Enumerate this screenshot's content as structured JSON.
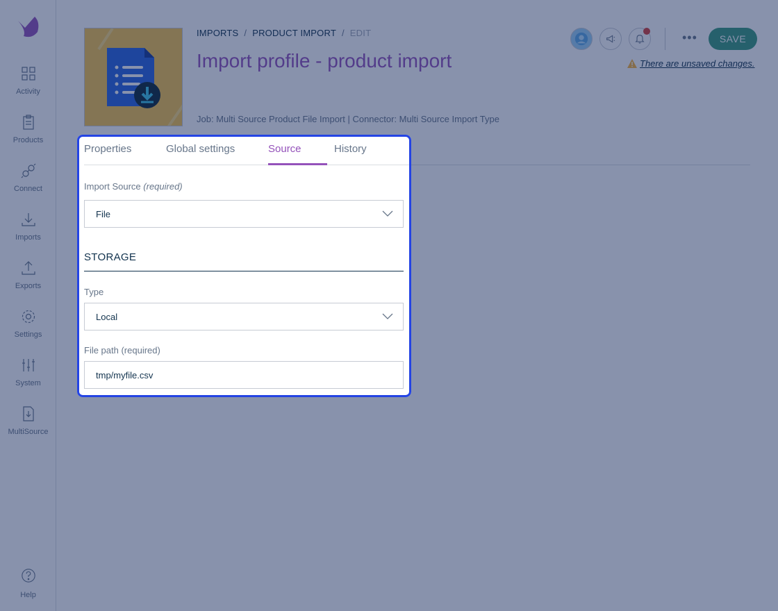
{
  "sidebar": {
    "items": [
      {
        "label": "Activity",
        "icon": "dashboard-icon"
      },
      {
        "label": "Products",
        "icon": "clipboard-icon"
      },
      {
        "label": "Connect",
        "icon": "plug-icon"
      },
      {
        "label": "Imports",
        "icon": "download-icon"
      },
      {
        "label": "Exports",
        "icon": "upload-icon"
      },
      {
        "label": "Settings",
        "icon": "gear-icon"
      },
      {
        "label": "System",
        "icon": "sliders-icon"
      },
      {
        "label": "MultiSource",
        "icon": "file-import-icon"
      }
    ],
    "help_label": "Help"
  },
  "breadcrumb": {
    "level1": "IMPORTS",
    "separator": "/",
    "level2": "PRODUCT IMPORT",
    "level3": "EDIT"
  },
  "header": {
    "title": "Import profile - product import",
    "subline": "Job: Multi Source Product File Import | Connector: Multi Source Import Type",
    "save_label": "SAVE",
    "more_label": "•••",
    "unsaved_text": "There are unsaved changes."
  },
  "tabs": [
    {
      "label": "Properties",
      "active": false
    },
    {
      "label": "Global settings",
      "active": false
    },
    {
      "label": "Source",
      "active": true
    },
    {
      "label": "History",
      "active": false
    }
  ],
  "form": {
    "import_source": {
      "label": "Import Source",
      "hint": "(required)",
      "value": "File"
    },
    "storage_title": "STORAGE",
    "type": {
      "label": "Type",
      "value": "Local"
    },
    "file_path": {
      "label": "File path (required)",
      "value": "tmp/myfile.csv"
    }
  },
  "colors": {
    "accent": "#9452ba",
    "save": "#3b9a7e",
    "highlight": "#2444e4",
    "notification": "#d4403a"
  }
}
